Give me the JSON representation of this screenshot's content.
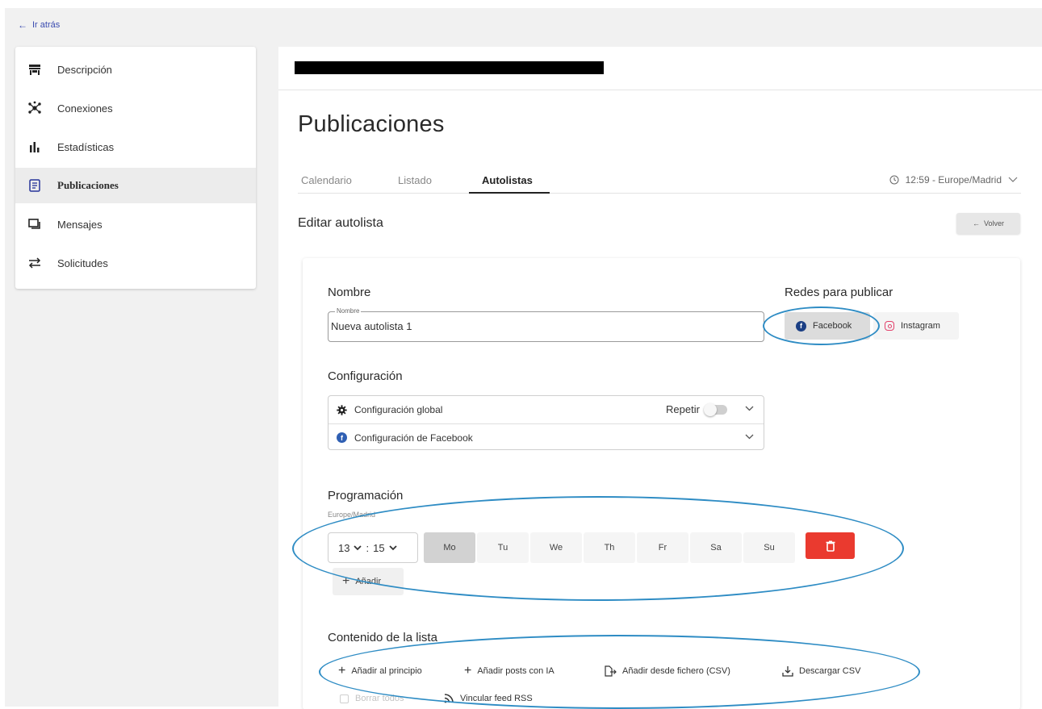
{
  "nav": {
    "back_label": "Ir atrás"
  },
  "sidebar": {
    "items": [
      {
        "label": "Descripción",
        "icon": "storefront-icon"
      },
      {
        "label": "Conexiones",
        "icon": "network-icon"
      },
      {
        "label": "Estadísticas",
        "icon": "bar-chart-icon"
      },
      {
        "label": "Publicaciones",
        "icon": "document-icon",
        "active": true
      },
      {
        "label": "Mensajes",
        "icon": "chat-icon"
      },
      {
        "label": "Solicitudes",
        "icon": "swap-icon"
      }
    ]
  },
  "page": {
    "title": "Publicaciones",
    "tabs": [
      {
        "label": "Calendario"
      },
      {
        "label": "Listado"
      },
      {
        "label": "Autolistas",
        "active": true
      }
    ],
    "timezone": "12:59 - Europe/Madrid",
    "edit_title": "Editar autolista",
    "volver_label": "Volver"
  },
  "form": {
    "name_section": "Nombre",
    "name_legend": "Nombre",
    "name_value": "Nueva autolista 1",
    "networks_section": "Redes para publicar",
    "networks": [
      {
        "label": "Facebook",
        "selected": true
      },
      {
        "label": "Instagram",
        "selected": false
      }
    ],
    "config_section": "Configuración",
    "config_rows": [
      {
        "label": "Configuración global"
      },
      {
        "label": "Configuración de Facebook"
      }
    ],
    "repeat_label": "Repetir",
    "repeat_on": false,
    "schedule_section": "Programación",
    "schedule_tz": "Europe/Madrid",
    "hour": "13",
    "minute": "15",
    "days": [
      {
        "label": "Mo",
        "active": true
      },
      {
        "label": "Tu",
        "active": false
      },
      {
        "label": "We",
        "active": false
      },
      {
        "label": "Th",
        "active": false
      },
      {
        "label": "Fr",
        "active": false
      },
      {
        "label": "Sa",
        "active": false
      },
      {
        "label": "Su",
        "active": false
      }
    ],
    "add_label": "Añadir",
    "content_section": "Contenido de la lista",
    "actions": [
      {
        "label": "Añadir al principio"
      },
      {
        "label": "Añadir posts con IA"
      },
      {
        "label": "Añadir desde fichero (CSV)"
      },
      {
        "label": "Descargar CSV"
      }
    ],
    "select_all_label": "Borrar todos",
    "rss_label": "Vincular feed RSS"
  },
  "colors": {
    "accent_link": "#3a4bb0",
    "delete_red": "#ea3a2f",
    "facebook_blue": "#1b3f84",
    "instagram_pink": "#e2406a",
    "annotation_blue": "#2e8cc4"
  }
}
